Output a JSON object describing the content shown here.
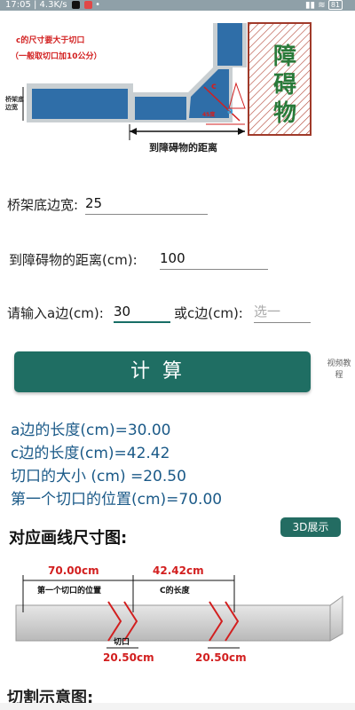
{
  "status_bar": {
    "time_speed": "17:05 | 4.3K/s",
    "battery": "81"
  },
  "top_diagram": {
    "note_line1": "c的尺寸要大于切口",
    "note_line2": "（一般取切口加10公分）",
    "bridge_label": "桥架底边宽",
    "obstacle_label": "障碍物",
    "distance_label": "到障碍物的距离",
    "label_c": "c",
    "label_a": "a",
    "label_angle": "45度"
  },
  "form": {
    "width_label": "桥架底边宽:",
    "width_value": "25",
    "distance_label": "到障碍物的距离(cm):",
    "distance_value": "100",
    "a_label": "请输入a边(cm):",
    "a_value": "30",
    "c_label": "或c边(cm):",
    "c_placeholder": "选一"
  },
  "calc_button": "计算",
  "video_link": "视频教程",
  "results": {
    "a_length": "a边的长度(cm)=30.00",
    "c_length": "c边的长度(cm)=42.42",
    "cut_size": "切口的大小 (cm) =20.50",
    "first_cut": "第一个切口的位置(cm)=70.00"
  },
  "section_title": "对应画线尺寸图:",
  "button_3d": "3D展示",
  "bottom_diagram": {
    "dim1": "70.00cm",
    "dim2": "42.42cm",
    "label1": "第一个切口的位置",
    "label2": "C的长度",
    "cut_label": "切口",
    "cut_size1": "20.50cm",
    "cut_size2": "20.50cm"
  },
  "cut_diagram_title": "切割示意图:",
  "colors": {
    "teal": "#1f6e63",
    "result_blue": "#1b5a88",
    "red": "#d21f1f",
    "obstacle_green": "#2a7a3a"
  }
}
